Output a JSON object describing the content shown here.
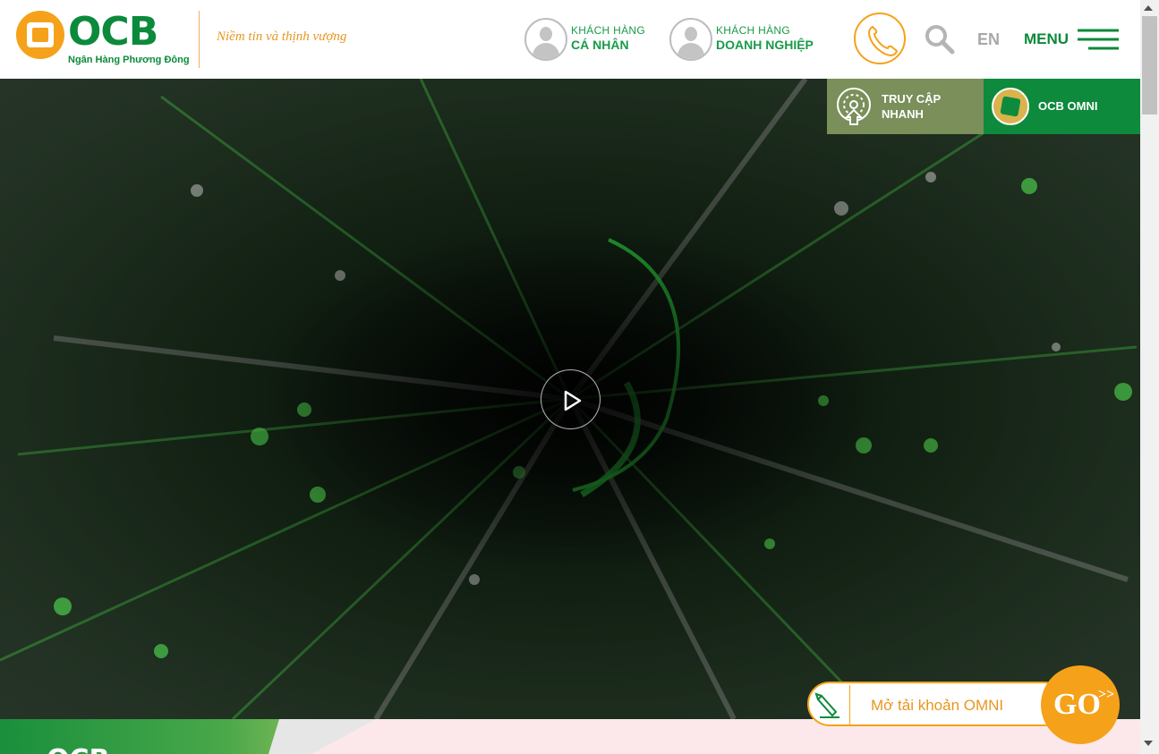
{
  "header": {
    "logo_text": "OCB",
    "logo_subtitle": "Ngân Hàng Phương Đông",
    "slogan": "Niềm tin và thịnh vượng",
    "personal": {
      "line1": "KHÁCH HÀNG",
      "line2": "CÁ NHÂN"
    },
    "business": {
      "line1": "KHÁCH HÀNG",
      "line2": "DOANH NGHIỆP"
    },
    "language": "EN",
    "menu_label": "MENU"
  },
  "quick_bar": {
    "quick_access_label": "TRUY CẬP NHANH",
    "omni_label": "OCB OMNI"
  },
  "cta": {
    "open_account_label": "Mở tải khoản OMNI",
    "go_label": "GO",
    "go_suffix": ">>"
  },
  "teaser": {
    "logo_text": "OCB"
  },
  "colors": {
    "brand_green": "#0c8a3b",
    "brand_orange": "#f5a21a",
    "quick_access_bg": "#7a8f5a",
    "omni_bg": "#0e8a3d"
  },
  "icons": [
    "avatar-personal-icon",
    "avatar-business-icon",
    "phone-icon",
    "search-icon",
    "hamburger-icon",
    "play-icon",
    "gauge-icon",
    "omni-logo-icon",
    "pen-icon",
    "mouse-scroll-icon"
  ]
}
